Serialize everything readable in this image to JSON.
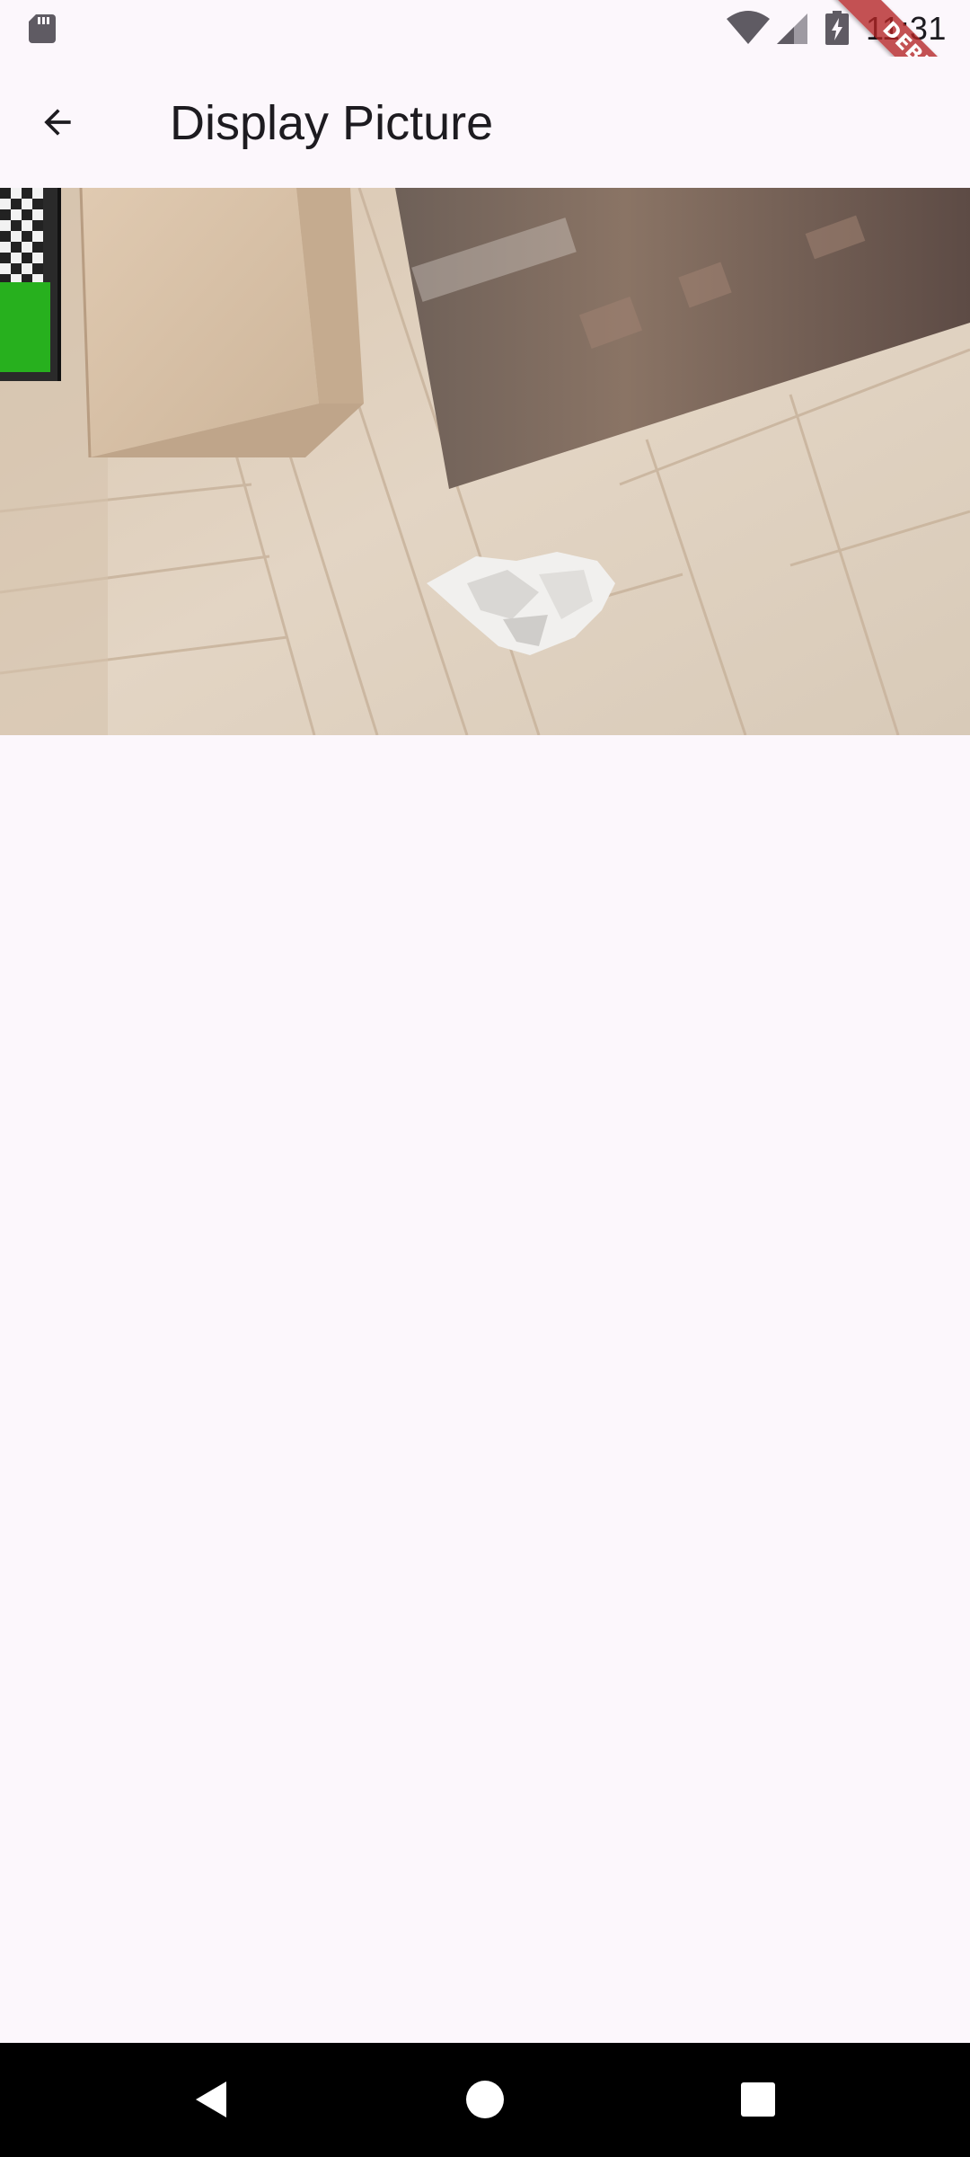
{
  "status_bar": {
    "time": "11:31",
    "icons": [
      "sd-card-icon",
      "wifi-icon",
      "cell-signal-icon",
      "battery-charging-icon"
    ]
  },
  "debug_banner": {
    "label": "DEBUG",
    "color": "#b22222"
  },
  "app_bar": {
    "back_icon": "arrow-back-icon",
    "title": "Display Picture"
  },
  "content": {
    "picture_icon": "captured-photo"
  },
  "nav_bar": {
    "icons": [
      "back-triangle-icon",
      "home-circle-icon",
      "recents-square-icon"
    ]
  },
  "colors": {
    "background": "#fcf7fc",
    "text": "#1d1b20",
    "nav_bar": "#000000"
  }
}
